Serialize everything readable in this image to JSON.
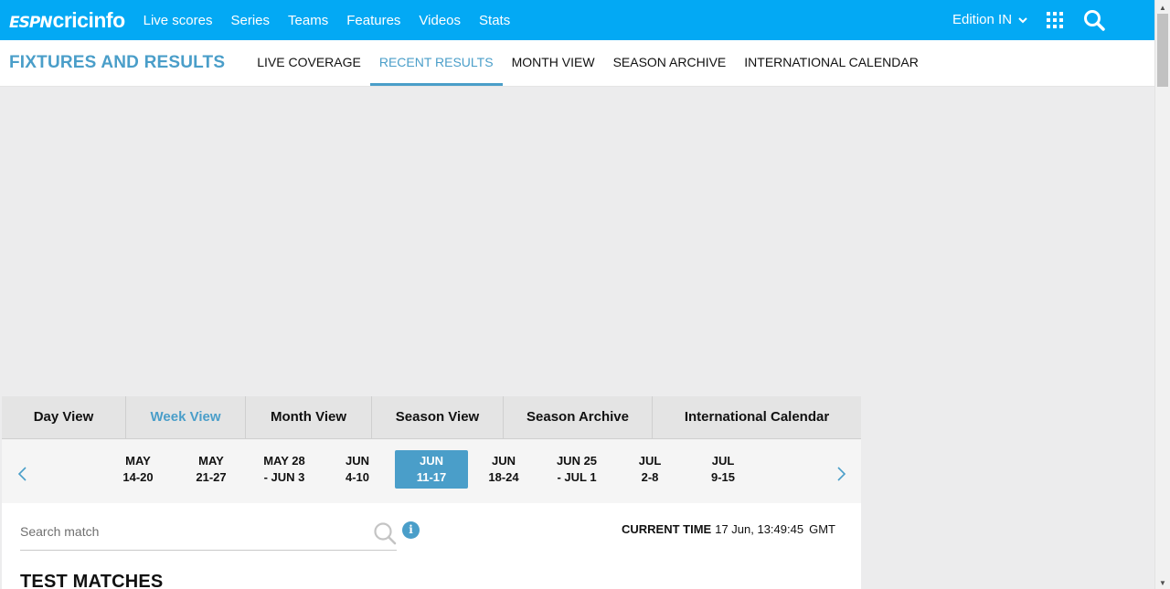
{
  "header": {
    "logo_espn": "ESPN",
    "logo_cric": "cricinfo",
    "nav": [
      "Live scores",
      "Series",
      "Teams",
      "Features",
      "Videos",
      "Stats"
    ],
    "edition": "Edition IN",
    "brand_color": "#03a9f4"
  },
  "subnav": {
    "title": "FIXTURES AND RESULTS",
    "tabs": [
      "LIVE COVERAGE",
      "RECENT RESULTS",
      "MONTH VIEW",
      "SEASON ARCHIVE",
      "INTERNATIONAL CALENDAR"
    ],
    "active_tab": "RECENT RESULTS",
    "accent_color": "#4a9ec9"
  },
  "view_tabs": {
    "items": [
      "Day View",
      "Week View",
      "Month View",
      "Season View",
      "Season Archive",
      "International Calendar"
    ],
    "active": "Week View"
  },
  "weeks": [
    {
      "l1": "MAY",
      "l2": "14-20"
    },
    {
      "l1": "MAY",
      "l2": "21-27"
    },
    {
      "l1": "MAY 28",
      "l2": "- JUN 3"
    },
    {
      "l1": "JUN",
      "l2": "4-10"
    },
    {
      "l1": "JUN",
      "l2": "11-17"
    },
    {
      "l1": "JUN",
      "l2": "18-24"
    },
    {
      "l1": "JUN 25",
      "l2": "- JUL 1"
    },
    {
      "l1": "JUL",
      "l2": "2-8"
    },
    {
      "l1": "JUL",
      "l2": "9-15"
    }
  ],
  "active_week": "JUN 11-17",
  "search": {
    "placeholder": "Search match"
  },
  "current_time": {
    "label": "CURRENT TIME",
    "value": "17 Jun, 13:49:45",
    "tz": "GMT"
  },
  "section_title": "TEST MATCHES"
}
